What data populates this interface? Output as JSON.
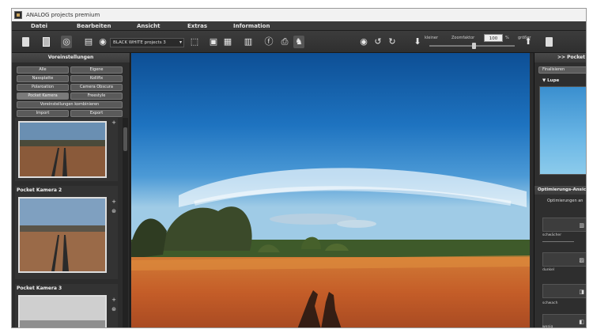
{
  "window": {
    "title": "ANALOG projects premium"
  },
  "menu": [
    {
      "label": "Datei"
    },
    {
      "label": "Bearbeiten"
    },
    {
      "label": "Ansicht"
    },
    {
      "label": "Extras"
    },
    {
      "label": "Information"
    }
  ],
  "toolbar": {
    "preset_select": "BLACK WHITE projects 3",
    "size_small": "kleiner",
    "size_big": "größer",
    "zoom_label": "Zoomfaktor",
    "zoom_value": "100",
    "zoom_unit": "%",
    "zoom_level": 0.5
  },
  "left_panel": {
    "title": "Voreinstellungen",
    "categories": [
      {
        "label": "Alle"
      },
      {
        "label": "Eigene"
      },
      {
        "label": "Nassplatte"
      },
      {
        "label": "Kollifix"
      },
      {
        "label": "Polaroation"
      },
      {
        "label": "Camera Obscura"
      },
      {
        "label": "Pocket Kamera"
      },
      {
        "label": "Freestyle"
      }
    ],
    "combine_button": "Voreinstellungen kombinieren",
    "import_button": "Import",
    "export_button": "Export",
    "presets": [
      {
        "title": ""
      },
      {
        "title": "Pocket Kamera 2"
      },
      {
        "title": "Pocket Kamera 3"
      }
    ]
  },
  "right_panel": {
    "header": ">> Pocket",
    "finalize_button": "Finalisieren",
    "lupe_label": "Lupe",
    "section_title": "Optimierungs-Ansicht",
    "section_sub": "Optimierungen an",
    "tiles": [
      {
        "label": "schwächer"
      },
      {
        "label": "dunkel"
      },
      {
        "label": "schwach"
      },
      {
        "label": "wenig"
      }
    ]
  },
  "colors": {
    "app_bg": "#2b2b2b",
    "panel_bg": "#2c2c2c",
    "sky_top": "#0f5ea8",
    "ground": "#c8602a"
  }
}
